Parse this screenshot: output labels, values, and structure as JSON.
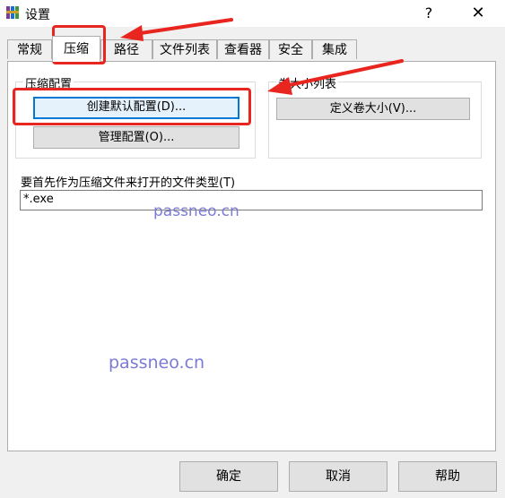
{
  "window": {
    "title": "设置",
    "help_glyph": "?",
    "close_glyph": "✕"
  },
  "tabs": [
    {
      "label": "常规"
    },
    {
      "label": "压缩"
    },
    {
      "label": "路径"
    },
    {
      "label": "文件列表"
    },
    {
      "label": "查看器"
    },
    {
      "label": "安全"
    },
    {
      "label": "集成"
    }
  ],
  "compression_profiles": {
    "group_title": "压缩配置",
    "create_default_label": "创建默认配置(D)...",
    "manage_label": "管理配置(O)..."
  },
  "volume_sizes": {
    "group_title": "卷大小列表",
    "define_label": "定义卷大小(V)..."
  },
  "file_types": {
    "label": "要首先作为压缩文件来打开的文件类型(T)",
    "value": "*.exe"
  },
  "watermark": {
    "text_top": "passneo.cn",
    "text_bottom": "passneo.cn"
  },
  "footer": {
    "ok_label": "确定",
    "cancel_label": "取消",
    "help_label": "帮助"
  },
  "colors": {
    "annotation": "#e8251f",
    "accent": "#0078d7"
  }
}
